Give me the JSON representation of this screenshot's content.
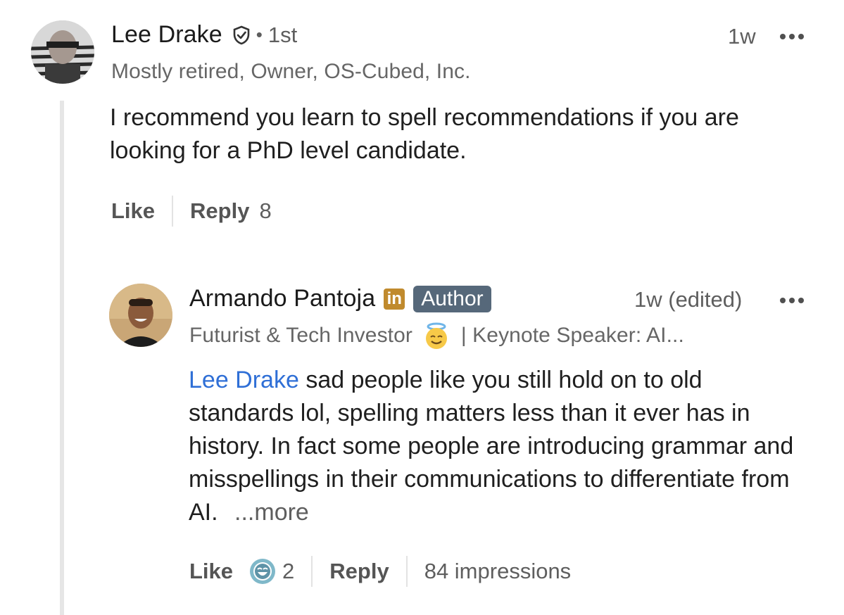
{
  "comments": [
    {
      "author": "Lee Drake",
      "degree": "1st",
      "headline": "Mostly retired, Owner, OS-Cubed, Inc.",
      "timestamp": "1w",
      "body": "I recommend you learn to spell recommendations if you are looking for a PhD level candidate.",
      "like_label": "Like",
      "reply_label": "Reply",
      "reply_count": "8",
      "icons": {
        "verified": "shield-check-icon",
        "more": "more-options-icon"
      }
    }
  ],
  "reply": {
    "author": "Armando Pantoja",
    "badge": "Author",
    "headline_before_emoji": "Futurist & Tech Investor",
    "headline_after_emoji": "| Keynote Speaker: AI...",
    "timestamp": "1w (edited)",
    "mention": "Lee Drake",
    "body": "sad people like you still hold on to old standards lol, spelling matters less than it ever has in history. In fact some people are introducing grammar and misspellings in their communications to differentiate from AI.",
    "see_more": "...more",
    "like_label": "Like",
    "reaction_count": "2",
    "reply_label": "Reply",
    "impressions": "84 impressions",
    "icons": {
      "premium": "linkedin-premium-icon",
      "emoji": "smiling-halo-emoji",
      "reaction": "laugh-reaction-icon",
      "more": "more-options-icon"
    }
  },
  "colors": {
    "mention": "#2f6fd6",
    "author_badge": "#56687a",
    "premium_icon": "#c08a2d",
    "thread_line": "#e6e6e6"
  }
}
